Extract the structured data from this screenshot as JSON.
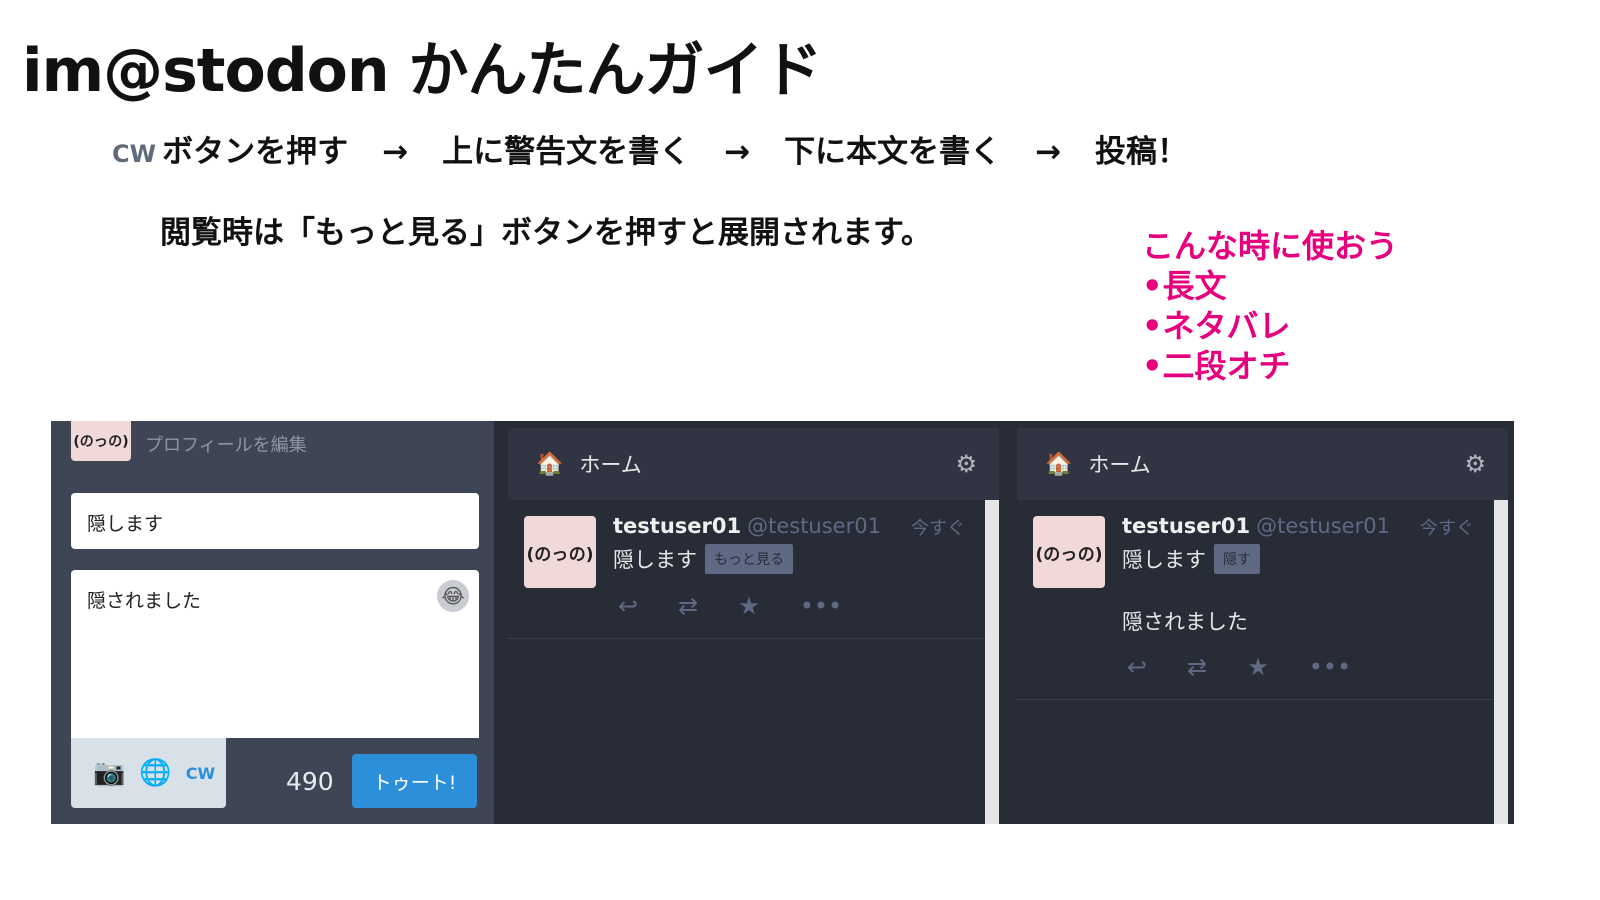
{
  "guide": {
    "title": "im@stodon かんたんガイド",
    "steps": {
      "cw_label": "CW",
      "step1": "ボタンを押す",
      "arrow": "→",
      "step2": "上に警告文を書く",
      "step3": "下に本文を書く",
      "step4": "投稿！"
    },
    "note": "閲覧時は「もっと見る」ボタンを押すと展開されます。",
    "usecases": {
      "heading": "こんな時に使おう",
      "items": [
        "長文",
        "ネタバレ",
        "二段オチ"
      ]
    }
  },
  "drawer": {
    "avatar_text": "(のっの)",
    "edit_profile": "プロフィールを編集",
    "cw_text": "隠します",
    "compose_text": "隠されました",
    "emoji_icon": "😂",
    "camera_icon": "📷",
    "globe_icon": "🌐",
    "cw_button": "CW",
    "char_count": "490",
    "toot_button": "トゥート!"
  },
  "columns": [
    {
      "header": "ホーム",
      "status": {
        "display_name": "testuser01",
        "acct": "@testuser01",
        "time": "今すぐ",
        "spoiler": "隠します",
        "toggle": "もっと見る",
        "content": ""
      }
    },
    {
      "header": "ホーム",
      "status": {
        "display_name": "testuser01",
        "acct": "@testuser01",
        "time": "今すぐ",
        "spoiler": "隠します",
        "toggle": "隠す",
        "content": "隠されました"
      }
    }
  ],
  "icons": {
    "home": "🏠",
    "gear": "⚙",
    "reply": "↩",
    "boost": "⇄",
    "favourite": "★",
    "more": "•••"
  },
  "colors": {
    "accent": "#2b90d9",
    "usecase_pink": "#e6007e",
    "drawer_bg": "#3e4655",
    "column_bg": "#282c37"
  }
}
